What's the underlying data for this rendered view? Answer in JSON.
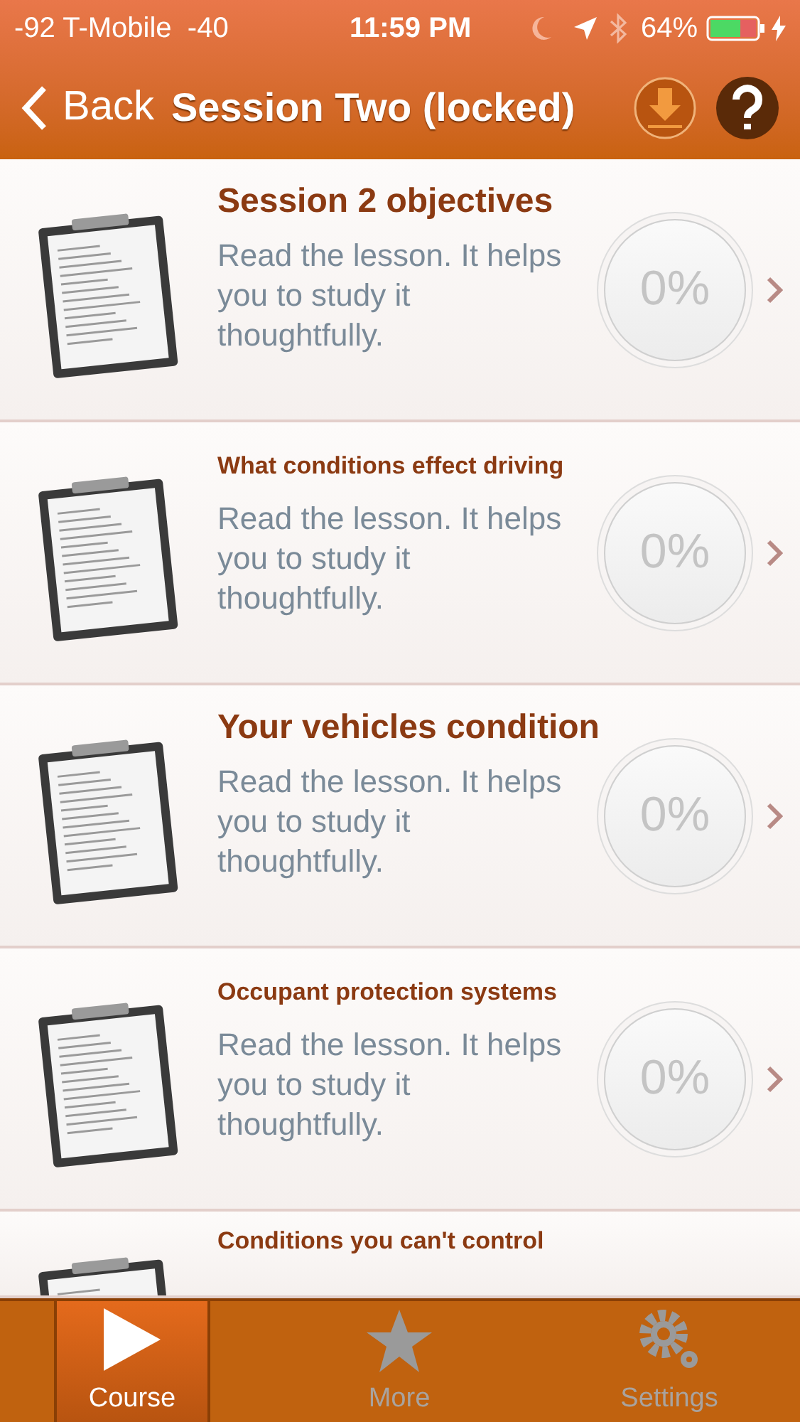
{
  "status_bar": {
    "carrier": "-92 T-Mobile  -40",
    "time": "11:59 PM",
    "battery": "64%"
  },
  "nav": {
    "back": "Back",
    "title": "Session Two (locked)"
  },
  "lessons": [
    {
      "title": "Session 2 objectives",
      "kind": "large",
      "description": "Read the lesson. It helps you to study it thoughtfully.",
      "progress": "0%"
    },
    {
      "title": "What conditions effect driving",
      "kind": "compact",
      "description": "Read the lesson. It helps you to study it thoughtfully.",
      "progress": "0%"
    },
    {
      "title": "Your vehicles condition",
      "kind": "large",
      "description": "Read the lesson. It helps you to study it thoughtfully.",
      "progress": "0%"
    },
    {
      "title": "Occupant protection systems",
      "kind": "compact",
      "description": "Read the lesson. It helps you to study it thoughtfully.",
      "progress": "0%"
    },
    {
      "title": "Conditions you can't control",
      "kind": "compact"
    }
  ],
  "tabs": [
    {
      "label": "Course",
      "kind": "play",
      "selected": true
    },
    {
      "label": "More",
      "kind": "star",
      "selected": false
    },
    {
      "label": "Settings",
      "kind": "gear",
      "selected": false
    }
  ]
}
